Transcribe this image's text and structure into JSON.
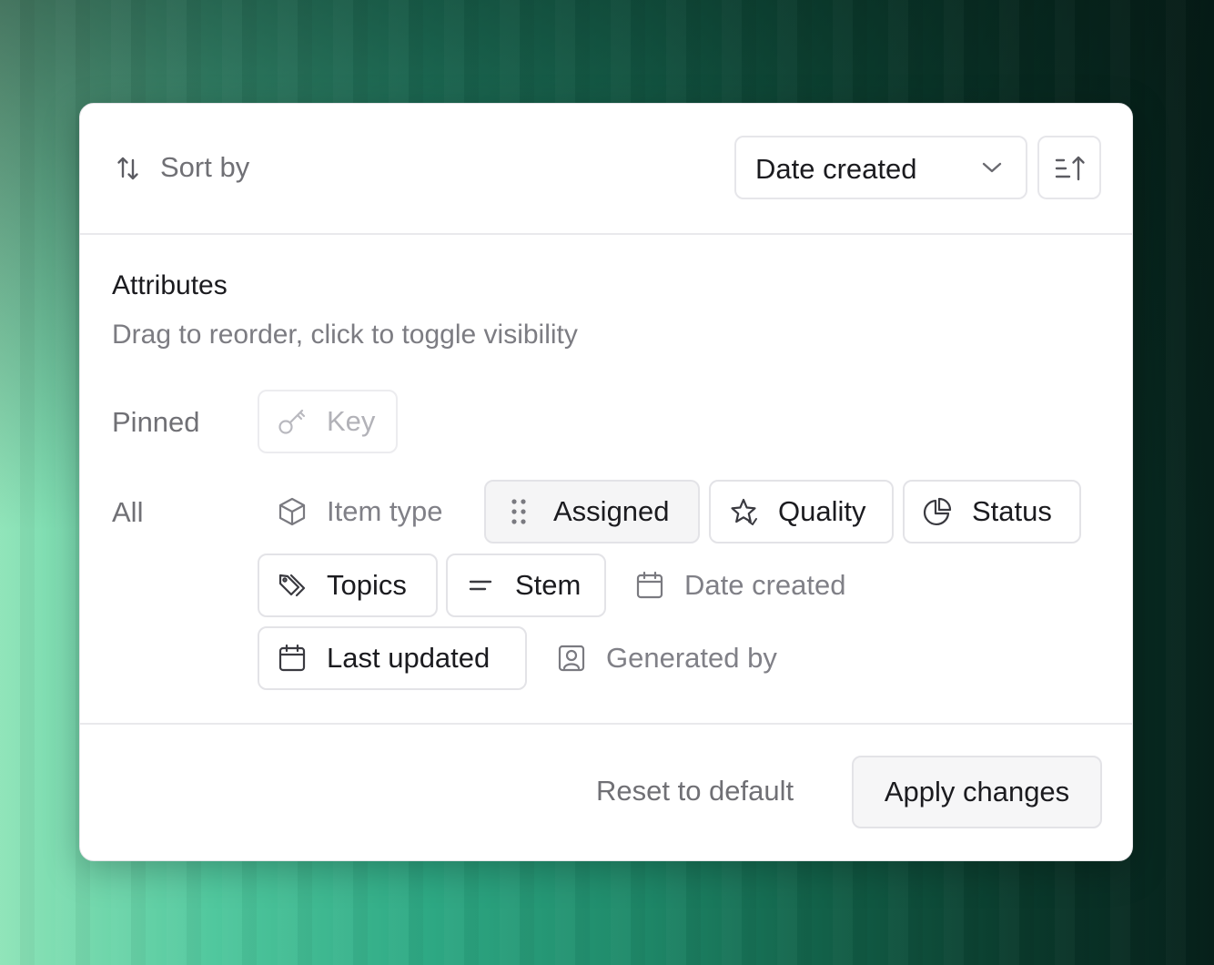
{
  "header": {
    "sort_label": "Sort by",
    "sort_select_value": "Date created"
  },
  "attributes": {
    "title": "Attributes",
    "subtitle": "Drag to reorder, click to toggle visibility",
    "pinned_label": "Pinned",
    "all_label": "All",
    "pinned": [
      {
        "label": "Key",
        "icon": "key-icon",
        "state": "disabled"
      }
    ],
    "all": [
      {
        "label": "Item type",
        "icon": "cube-icon",
        "visible": false
      },
      {
        "label": "Assigned",
        "icon": "drag-handle-icon",
        "visible": true,
        "dragging": true
      },
      {
        "label": "Quality",
        "icon": "star-icon",
        "visible": true
      },
      {
        "label": "Status",
        "icon": "pie-chart-icon",
        "visible": true
      },
      {
        "label": "Topics",
        "icon": "tags-icon",
        "visible": true
      },
      {
        "label": "Stem",
        "icon": "text-lines-icon",
        "visible": true
      },
      {
        "label": "Date created",
        "icon": "calendar-icon",
        "visible": false
      },
      {
        "label": "Last updated",
        "icon": "calendar-icon",
        "visible": true
      },
      {
        "label": "Generated by",
        "icon": "user-portrait-icon",
        "visible": false
      }
    ]
  },
  "footer": {
    "reset_label": "Reset to default",
    "apply_label": "Apply changes"
  }
}
